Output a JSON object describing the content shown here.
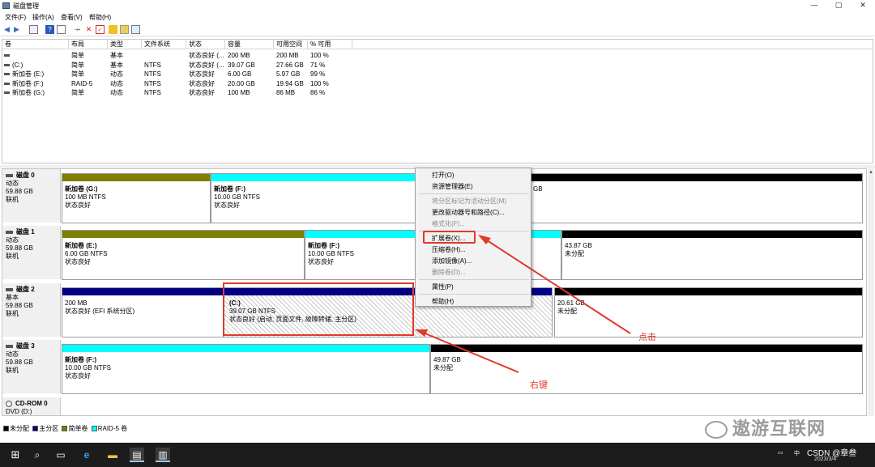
{
  "window": {
    "title": "磁盘管理",
    "min": "—",
    "max": "▢",
    "close": "✕"
  },
  "menu": [
    "文件(F)",
    "操作(A)",
    "查看(V)",
    "帮助(H)"
  ],
  "volume_table": {
    "headers": [
      "卷",
      "布局",
      "类型",
      "文件系统",
      "状态",
      "容量",
      "可用空间",
      "% 可用"
    ],
    "rows": [
      [
        "",
        "简单",
        "基本",
        "",
        "状态良好 (...",
        "200 MB",
        "200 MB",
        "100 %"
      ],
      [
        "(C:)",
        "简单",
        "基本",
        "NTFS",
        "状态良好 (...",
        "39.07 GB",
        "27.66 GB",
        "71 %"
      ],
      [
        "新加卷 (E:)",
        "简单",
        "动态",
        "NTFS",
        "状态良好",
        "6.00 GB",
        "5.97 GB",
        "99 %"
      ],
      [
        "新加卷 (F:)",
        "RAID-5",
        "动态",
        "NTFS",
        "状态良好",
        "20.00 GB",
        "19.94 GB",
        "100 %"
      ],
      [
        "新加卷 (G:)",
        "简单",
        "动态",
        "NTFS",
        "状态良好",
        "100 MB",
        "86 MB",
        "86 %"
      ]
    ]
  },
  "disks": [
    {
      "name": "磁盘 0",
      "type": "动态",
      "size": "59.88 GB",
      "status": "联机",
      "parts": [
        {
          "l1": "新加卷 (G:)",
          "l2": "100 MB NTFS",
          "l3": "状态良好"
        },
        {
          "l1": "新加卷 (F:)",
          "l2": "10.00 GB NTFS",
          "l3": "状态良好"
        },
        {
          "l1": "",
          "l2": "GB",
          "l3": ""
        }
      ]
    },
    {
      "name": "磁盘 1",
      "type": "动态",
      "size": "59.88 GB",
      "status": "联机",
      "parts": [
        {
          "l1": "新加卷 (E:)",
          "l2": "6.00 GB NTFS",
          "l3": "状态良好"
        },
        {
          "l1": "新加卷 (F:)",
          "l2": "10.00 GB NTFS",
          "l3": "状态良好"
        },
        {
          "l1": "",
          "l2": "43.87 GB",
          "l3": "未分配"
        }
      ]
    },
    {
      "name": "磁盘 2",
      "type": "基本",
      "size": "59.88 GB",
      "status": "联机",
      "parts": [
        {
          "l1": "",
          "l2": "200 MB",
          "l3": "状态良好 (EFI 系统分区)"
        },
        {
          "l1": "(C:)",
          "l2": "39.07 GB NTFS",
          "l3": "状态良好 (启动, 页面文件, 故障转储, 主分区)"
        },
        {
          "l1": "",
          "l2": "20.61 GB",
          "l3": "未分配"
        }
      ]
    },
    {
      "name": "磁盘 3",
      "type": "动态",
      "size": "59.88 GB",
      "status": "联机",
      "parts": [
        {
          "l1": "新加卷 (F:)",
          "l2": "10.00 GB NTFS",
          "l3": "状态良好"
        },
        {
          "l1": "",
          "l2": "49.87 GB",
          "l3": "未分配"
        }
      ]
    }
  ],
  "cdrom": {
    "name": "CD-ROM 0",
    "line2": "DVD (D:)"
  },
  "legend": [
    "未分配",
    "主分区",
    "简单卷",
    "RAID-5 卷"
  ],
  "context_menu": {
    "open": "打开(O)",
    "explorer": "资源管理器(E)",
    "mark_active": "将分区标记为活动分区(M)",
    "change_letter": "更改驱动器号和路径(C)...",
    "format": "格式化(F)...",
    "extend": "扩展卷(X)...",
    "shrink": "压缩卷(H)...",
    "mirror": "添加镜像(A)...",
    "delete": "删除卷(D)...",
    "properties": "属性(P)",
    "help": "帮助(H)"
  },
  "annotations": {
    "click": "点击",
    "right_click": "右键"
  },
  "watermark": "遨游互联网",
  "taskbar": {
    "tray": "CSDN @章叁",
    "date": "2023/3/4",
    "ime": "中"
  },
  "colors": {
    "simple": "#808000",
    "raid5": "#00ffff",
    "primary": "#000080",
    "unalloc": "#000000",
    "annotation": "#e03a2a"
  }
}
